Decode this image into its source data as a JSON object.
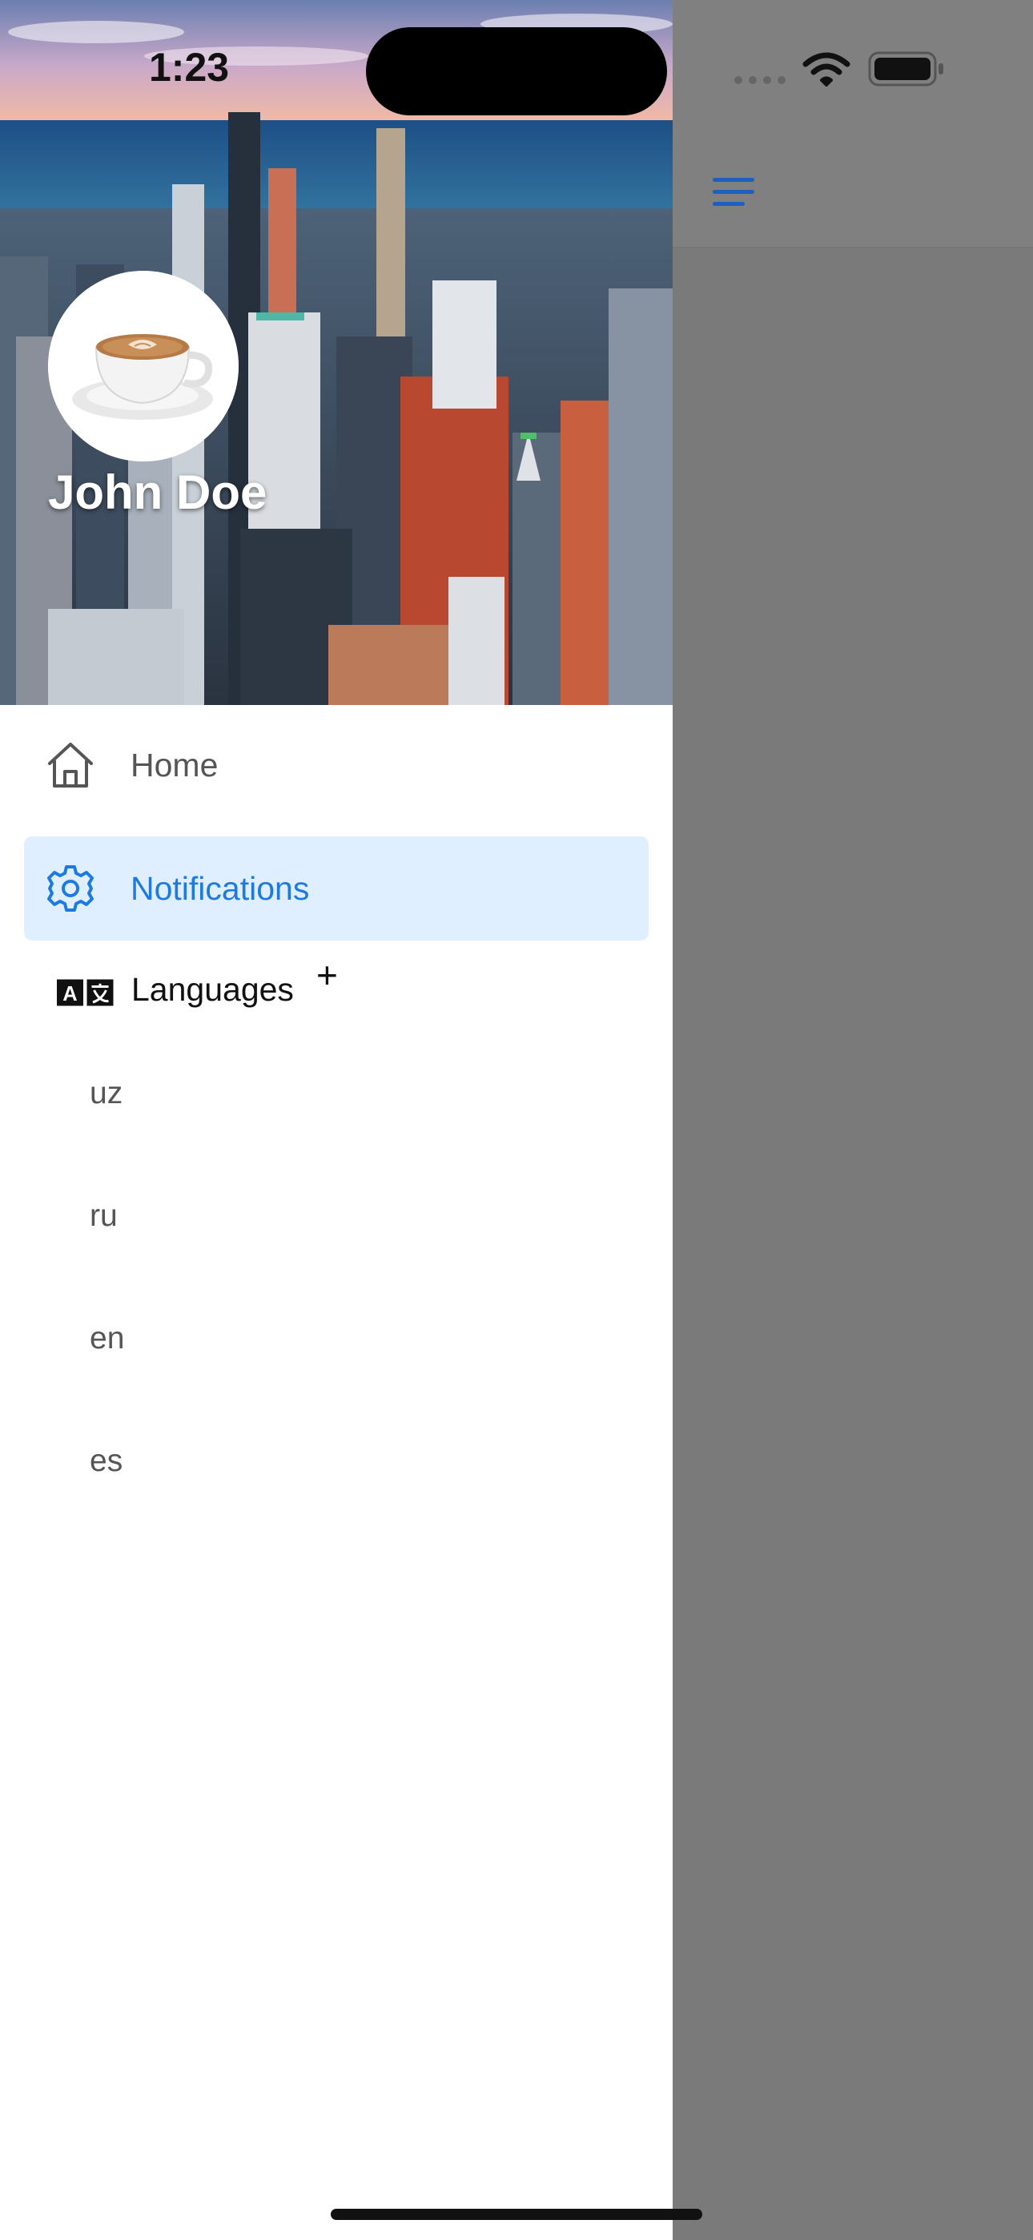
{
  "status_bar": {
    "time": "1:23",
    "wifi_icon": "wifi-icon",
    "battery_icon": "battery-icon",
    "cellular_icon": "cellular-signal-icon"
  },
  "app_header": {
    "menu_icon": "menu-icon",
    "accent": "#1f5fbf"
  },
  "drawer": {
    "header_image": "city-skyline-image",
    "avatar_image": "coffee-cup-image",
    "user_name": "John Doe",
    "items": [
      {
        "label": "Home",
        "icon": "home-icon",
        "selected": false
      },
      {
        "label": "Notifications",
        "icon": "gear-icon",
        "selected": true
      },
      {
        "label": "Languages",
        "icon": "translate-icon",
        "expand_symbol": "+"
      }
    ],
    "languages": [
      "uz",
      "ru",
      "en",
      "es"
    ]
  },
  "colors": {
    "selected_background": "#e0efff",
    "selected_text": "#1f7ae0",
    "overlay": "#7a7a7a"
  }
}
